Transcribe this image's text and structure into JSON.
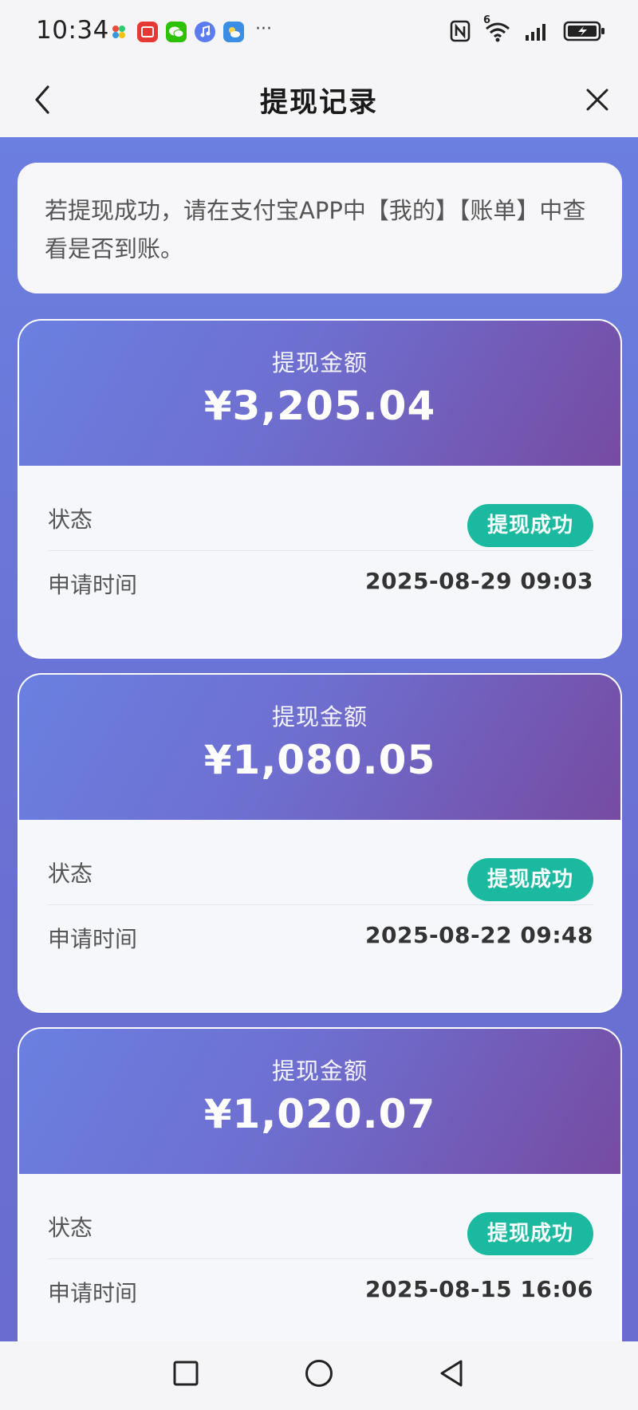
{
  "status_bar": {
    "time": "10:34",
    "notification_icons": [
      "photos-app-icon",
      "red-app-icon",
      "wechat-icon",
      "music-icon",
      "weather-icon"
    ],
    "more": "···",
    "signal": "6",
    "icons": [
      "nfc-icon",
      "wifi-icon",
      "signal-icon",
      "battery-charging-icon"
    ]
  },
  "header": {
    "title": "提现记录",
    "back_icon": "chevron-left-icon",
    "close_icon": "close-icon"
  },
  "notice": {
    "text": "若提现成功，请在支付宝APP中【我的】【账单】中查看是否到账。"
  },
  "records": [
    {
      "amount_label": "提现金额",
      "amount": "¥3,205.04",
      "status_label": "状态",
      "status": "提现成功",
      "time_label": "申请时间",
      "time": "2025-08-29 09:03"
    },
    {
      "amount_label": "提现金额",
      "amount": "¥1,080.05",
      "status_label": "状态",
      "status": "提现成功",
      "time_label": "申请时间",
      "time": "2025-08-22 09:48"
    },
    {
      "amount_label": "提现金额",
      "amount": "¥1,020.07",
      "status_label": "状态",
      "status": "提现成功",
      "time_label": "申请时间",
      "time": "2025-08-15 16:06"
    }
  ],
  "colors": {
    "accent": "#6a7ad8",
    "status_success": "#1bb9a0",
    "card_gradient_end": "#764ba2"
  },
  "nav_bar": {
    "icons": [
      "recent-apps-icon",
      "home-icon",
      "back-triangle-icon"
    ]
  }
}
